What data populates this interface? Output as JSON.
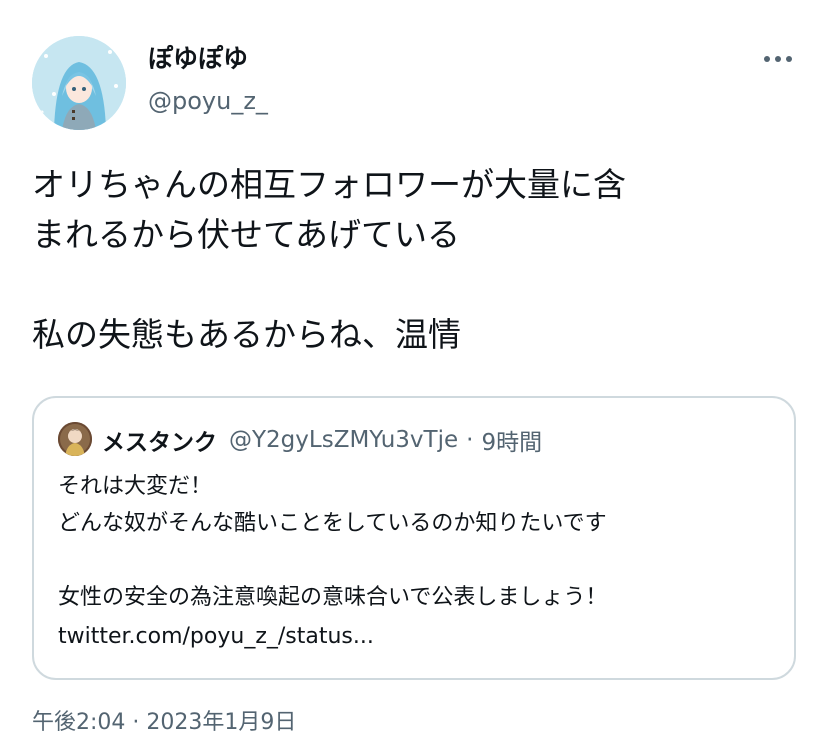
{
  "author": {
    "display_name": "ぽゆぽゆ",
    "handle": "@poyu_z_"
  },
  "icons": {
    "more": "more-horizontal-icon"
  },
  "tweet": {
    "text": "オリちゃんの相互フォロワーが大量に含\nまれるから伏せてあげている\n\n私の失態もあるからね、温情",
    "timestamp": "午後2:04 · 2023年1月9日"
  },
  "quote": {
    "display_name": "メスタンク",
    "handle": "@Y2gyLsZMYu3vTje",
    "separator": "·",
    "time": "9時間",
    "text": "それは大変だ！\nどんな奴がそんな酷いことをしているのか知りたいです\n\n女性の安全の為注意喚起の意味合いで公表しましょう！",
    "link": "twitter.com/poyu_z_/status..."
  },
  "colors": {
    "text": "#0f1419",
    "secondary": "#536471",
    "border": "#cfd9de"
  }
}
